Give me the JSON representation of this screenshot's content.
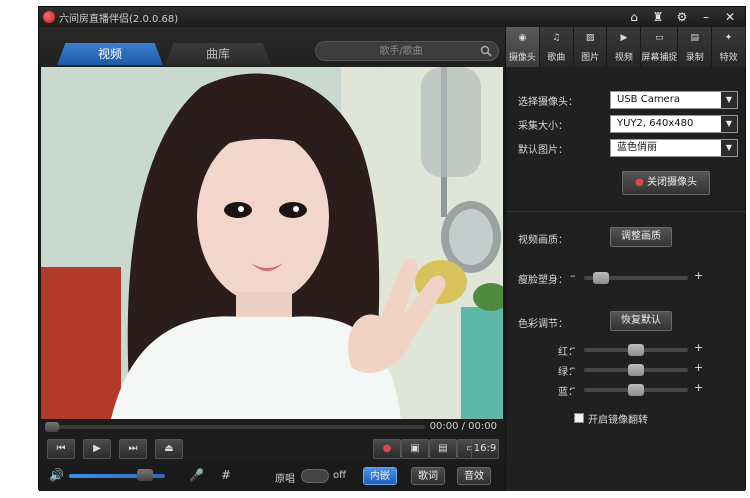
{
  "window": {
    "title": "六间房直播伴侣(2.0.0.68)",
    "controls": [
      "home-icon",
      "shirt-icon",
      "gear-icon",
      "minimize-icon",
      "close-icon"
    ]
  },
  "nav": {
    "tabs": [
      {
        "label": "视频",
        "active": true
      },
      {
        "label": "曲库",
        "active": false
      }
    ],
    "search_placeholder": "歌手/歌曲"
  },
  "player": {
    "time": "00:00 / 00:00",
    "controls": [
      "prev-icon",
      "play-icon",
      "next-icon",
      "eject-icon"
    ],
    "right_controls": [
      "camera-red-icon",
      "snapshot-icon",
      "film-icon",
      "screen-icon"
    ],
    "aspect_label": "16:9",
    "volume": 0.85
  },
  "bottom": {
    "hash_label": "#",
    "mute_label": "原唱",
    "switch_label": "off",
    "buttons": [
      {
        "label": "内嵌",
        "style": "blue"
      },
      {
        "label": "歌词",
        "style": "grey"
      },
      {
        "label": "音效",
        "style": "grey"
      }
    ]
  },
  "right_tabs": [
    {
      "label": "摄像头",
      "icon": "webcam-icon",
      "active": true
    },
    {
      "label": "歌曲",
      "icon": "music-note-icon",
      "active": false
    },
    {
      "label": "图片",
      "icon": "picture-icon",
      "active": false
    },
    {
      "label": "视频",
      "icon": "video-camera-icon",
      "active": false
    },
    {
      "label": "屏幕捕捉",
      "icon": "monitor-icon",
      "active": false
    },
    {
      "label": "录制",
      "icon": "record-icon",
      "active": false
    },
    {
      "label": "特效",
      "icon": "magic-wand-icon",
      "active": false
    }
  ],
  "camera": {
    "select_label": "选择摄像头：",
    "select_value": "USB Camera",
    "size_label": "采集大小：",
    "size_value": "YUY2, 640x480",
    "default_pic_label": "默认图片：",
    "default_pic_value": "蓝色俏丽",
    "close_button": "关闭摄像头",
    "quality_label": "视频画质：",
    "quality_button": "调整画质",
    "slim_label": "瘦脸塑身：",
    "slim_value": 0.1,
    "color_label": "色彩调节：",
    "reset_button": "恢复默认",
    "red_label": "红：",
    "red_value": 0.5,
    "green_label": "绿：",
    "green_value": 0.5,
    "blue_label": "蓝：",
    "blue_value": 0.5,
    "mirror_label": "开启镜像翻转",
    "mirror_checked": false
  }
}
